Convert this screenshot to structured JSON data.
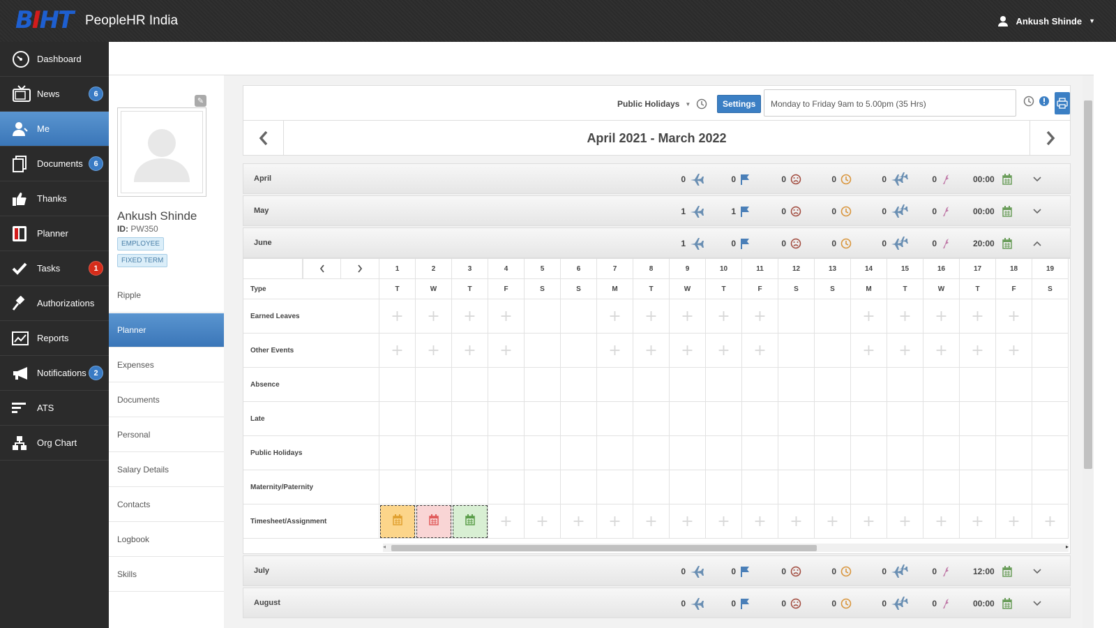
{
  "app": {
    "title": "PeopleHR India",
    "logo": "BIHT",
    "user_name": "Ankush Shinde"
  },
  "sidebar": {
    "items": [
      {
        "label": "Dashboard",
        "icon": "dashboard-icon"
      },
      {
        "label": "News",
        "icon": "tv-icon",
        "badge": "6"
      },
      {
        "label": "Me",
        "icon": "user-icon",
        "active": true
      },
      {
        "label": "Documents",
        "icon": "documents-icon",
        "badge": "6"
      },
      {
        "label": "Thanks",
        "icon": "thumbs-up-icon"
      },
      {
        "label": "Planner",
        "icon": "planner-icon"
      },
      {
        "label": "Tasks",
        "icon": "check-icon",
        "badge": "1"
      },
      {
        "label": "Authorizations",
        "icon": "gavel-icon"
      },
      {
        "label": "Reports",
        "icon": "chart-icon"
      },
      {
        "label": "Notifications",
        "icon": "megaphone-icon",
        "badge": "2"
      },
      {
        "label": "ATS",
        "icon": "ats-icon"
      },
      {
        "label": "Org Chart",
        "icon": "org-chart-icon"
      }
    ]
  },
  "profile": {
    "name": "Ankush Shinde",
    "id_label": "ID:",
    "id_value": "PW350",
    "tags": [
      "EMPLOYEE",
      "FIXED TERM"
    ],
    "menu": [
      "Ripple",
      "Planner",
      "Expenses",
      "Documents",
      "Personal",
      "Salary Details",
      "Contacts",
      "Logbook",
      "Skills"
    ],
    "active_menu": "Planner"
  },
  "toolbar": {
    "public_holidays": "Public Holidays",
    "settings": "Settings",
    "shift": "Monday to Friday 9am to 5.00pm (35 Hrs)"
  },
  "year_title": "April 2021 - March 2022",
  "months": [
    {
      "name": "April",
      "values": [
        "0",
        "0",
        "0",
        "0",
        "0",
        "0"
      ],
      "time": "00:00",
      "expanded": false
    },
    {
      "name": "May",
      "values": [
        "1",
        "1",
        "0",
        "0",
        "0",
        "0"
      ],
      "time": "00:00",
      "expanded": false
    },
    {
      "name": "June",
      "values": [
        "1",
        "0",
        "0",
        "0",
        "0",
        "0"
      ],
      "time": "20:00",
      "expanded": true
    },
    {
      "name": "July",
      "values": [
        "0",
        "0",
        "0",
        "0",
        "0",
        "0"
      ],
      "time": "12:00",
      "expanded": false
    },
    {
      "name": "August",
      "values": [
        "0",
        "0",
        "0",
        "0",
        "0",
        "0"
      ],
      "time": "00:00",
      "expanded": false
    }
  ],
  "grid": {
    "type_label": "Type",
    "days": [
      "1",
      "2",
      "3",
      "4",
      "5",
      "6",
      "7",
      "8",
      "9",
      "10",
      "11",
      "12",
      "13",
      "14",
      "15",
      "16",
      "17",
      "18",
      "19"
    ],
    "weekdays": [
      "T",
      "W",
      "T",
      "F",
      "S",
      "S",
      "M",
      "T",
      "W",
      "T",
      "F",
      "S",
      "S",
      "M",
      "T",
      "W",
      "T",
      "F",
      "S"
    ],
    "rows": [
      "Earned Leaves",
      "Other Events",
      "Absence",
      "Late",
      "Public Holidays",
      "Maternity/Paternity",
      "Timesheet/Assignment"
    ],
    "plus_glyph": "+",
    "timesheet_colors": [
      "#fcd58a",
      "#f9d5d5",
      "#d8efd3"
    ]
  }
}
